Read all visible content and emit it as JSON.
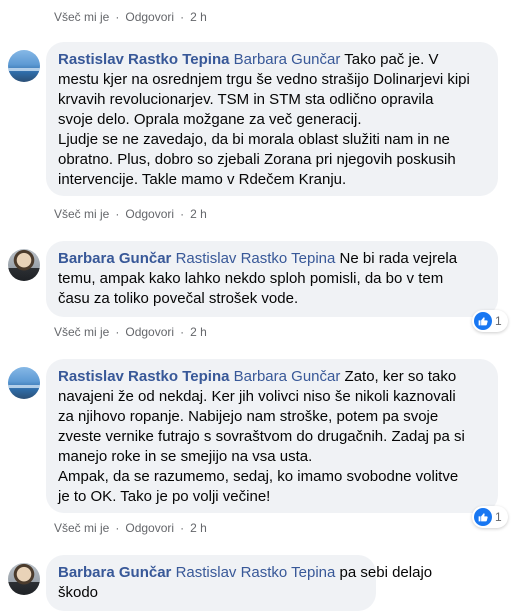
{
  "comments": [
    {
      "actions": {
        "like": "Všeč mi je",
        "reply": "Odgovori",
        "time": "2 h"
      }
    },
    {
      "author": "Rastislav Rastko Tepina",
      "mention": "Barbara Gunčar",
      "first_line_text": " Tako pač je. V",
      "lines": [
        "mestu kjer na osrednjem trgu še vedno strašijo Dolinarjevi kipi",
        "krvavih revolucionarjev. TSM in STM sta odlično opravila",
        "svoje delo. Oprala možgane za več generacij.",
        "Ljudje se ne zavedajo, da bi morala oblast služiti nam in ne",
        "obratno. Plus, dobro so zjebali Zorana pri njegovih poskusih",
        "intervencije. Takle mamo v Rdečem Kranju."
      ],
      "actions": {
        "like": "Všeč mi je",
        "reply": "Odgovori",
        "time": "2 h"
      }
    },
    {
      "author": "Barbara Gunčar",
      "mention": "Rastislav Rastko Tepina",
      "first_line_text": " Ne bi rada vejrela",
      "lines": [
        "temu, ampak kako lahko nekdo sploh pomisli, da bo v tem",
        "času za toliko povečal strošek vode."
      ],
      "reaction_count": "1",
      "actions": {
        "like": "Všeč mi je",
        "reply": "Odgovori",
        "time": "2 h"
      }
    },
    {
      "author": "Rastislav Rastko Tepina",
      "mention": "Barbara Gunčar",
      "first_line_text": " Zato, ker so tako",
      "lines": [
        "navajeni že od nekdaj. Ker jih volivci niso še nikoli kaznovali",
        "za njihovo ropanje. Nabijejo nam stroške, potem pa svoje",
        "zveste vernike futrajo s sovraštvom do drugačnih. Zadaj pa si",
        "manejo roke in se smejijo na vsa usta.",
        "Ampak, da se razumemo, sedaj, ko imamo svobodne volitve",
        "je to OK. Tako je po volji večine!"
      ],
      "reaction_count": "1",
      "actions": {
        "like": "Všeč mi je",
        "reply": "Odgovori",
        "time": "2 h"
      }
    },
    {
      "author": "Barbara Gunčar",
      "mention": "Rastislav Rastko Tepina",
      "first_line_text": " pa sebi delajo",
      "lines": [
        "škodo"
      ]
    }
  ]
}
